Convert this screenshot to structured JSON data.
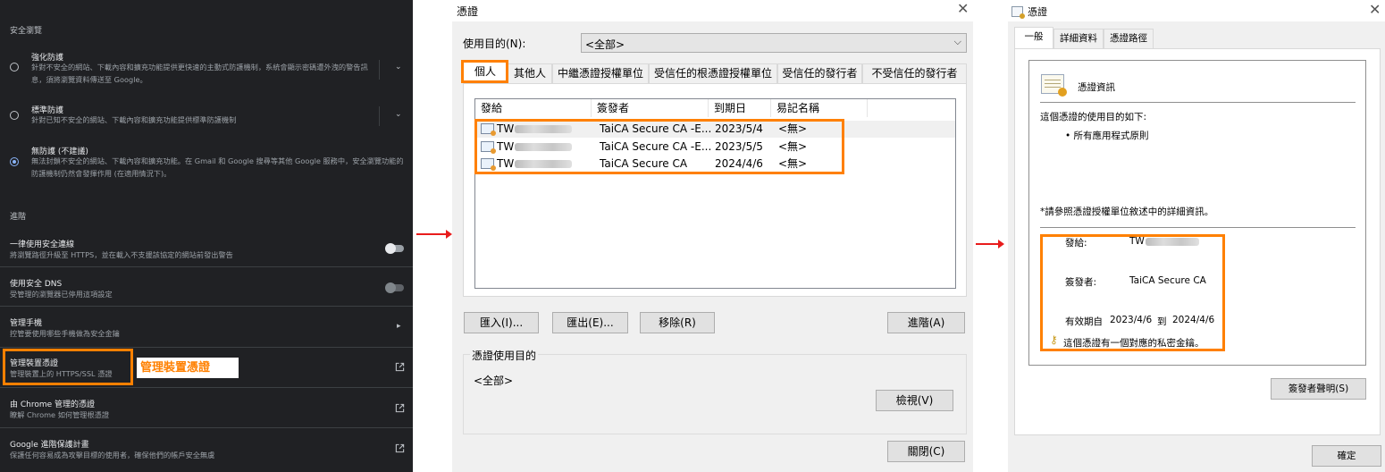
{
  "settings": {
    "section_safe_browsing": "安全瀏覽",
    "options": [
      {
        "title": "強化防護",
        "desc": "針對不安全的網站、下載內容和擴充功能提供更快速的主動式防護機制，系統會顯示密碼遭外洩的警告訊息，須將瀏覽資料傳送至 Google。",
        "selected": false
      },
      {
        "title": "標準防護",
        "desc": "針對已知不安全的網站、下載內容和擴充功能提供標準防護機制",
        "selected": false
      },
      {
        "title": "無防護 (不建議)",
        "desc": "無法封鎖不安全的網站、下載內容和擴充功能。在 Gmail 和 Google 搜尋等其他 Google 服務中，安全瀏覽功能的防護機制仍然會發揮作用 (在適用情況下)。",
        "selected": true
      }
    ],
    "section_advanced": "進階",
    "items": [
      {
        "title": "一律使用安全連線",
        "desc": "將瀏覽路徑升級至 HTTPS，並在載入不支援該協定的網站前發出警告"
      },
      {
        "title": "使用安全 DNS",
        "desc": "受管理的瀏覽器已停用這項設定"
      },
      {
        "title": "管理手機",
        "desc": "控管要使用哪些手機做為安全金鑰"
      },
      {
        "title": "管理裝置憑證",
        "desc": "管理裝置上的 HTTPS/SSL 憑證"
      },
      {
        "title": "由 Chrome 管理的憑證",
        "desc": "瞭解 Chrome 如何管理根憑證"
      },
      {
        "title": "Google 進階保護計畫",
        "desc": "保護任何容易成為攻擊目標的使用者，確保他們的帳戶安全無虞"
      }
    ],
    "callout": "管理裝置憑證",
    "colors": {
      "background": "#202124",
      "highlight": "#ff8000",
      "accent": "#8ab4f8"
    }
  },
  "certmgr": {
    "title": "憑證",
    "purpose_label": "使用目的(N):",
    "purpose_value": "<全部>",
    "tabs": [
      "個人",
      "其他人",
      "中繼憑證授權單位",
      "受信任的根憑證授權單位",
      "受信任的發行者",
      "不受信任的發行者"
    ],
    "columns": [
      "發給",
      "簽發者",
      "到期日",
      "易記名稱"
    ],
    "rows": [
      {
        "issued_to": "TW",
        "issuer": "TaiCA Secure CA -E...",
        "expires": "2023/5/4",
        "friendly": "<無>"
      },
      {
        "issued_to": "TW",
        "issuer": "TaiCA Secure CA -E...",
        "expires": "2023/5/5",
        "friendly": "<無>"
      },
      {
        "issued_to": "TW",
        "issuer": "TaiCA Secure CA",
        "expires": "2024/4/6",
        "friendly": "<無>"
      }
    ],
    "buttons": {
      "import": "匯入(I)...",
      "export": "匯出(E)...",
      "remove": "移除(R)",
      "advanced": "進階(A)",
      "view": "檢視(V)",
      "close": "關閉(C)"
    },
    "purpose_group_title": "憑證使用目的",
    "purpose_group_value": "<全部>"
  },
  "certinfo": {
    "title": "憑證",
    "tabs": [
      "一般",
      "詳細資料",
      "憑證路徑"
    ],
    "heading": "憑證資訊",
    "purpose_intro": "這個憑證的使用目的如下:",
    "purpose_item": "• 所有應用程式原則",
    "note": "*請參照憑證授權單位敘述中的詳細資訊。",
    "issued_to_label": "發給:",
    "issued_to_value": "TW",
    "issuer_label": "簽發者:",
    "issuer_value": "TaiCA Secure CA",
    "valid_label": "有效期自",
    "valid_from": "2023/4/6",
    "valid_to_word": "到",
    "valid_to": "2024/4/6",
    "private_key": "這個憑證有一個對應的私密金鑰。",
    "issuer_statement": "簽發者聲明(S)",
    "ok": "確定"
  }
}
